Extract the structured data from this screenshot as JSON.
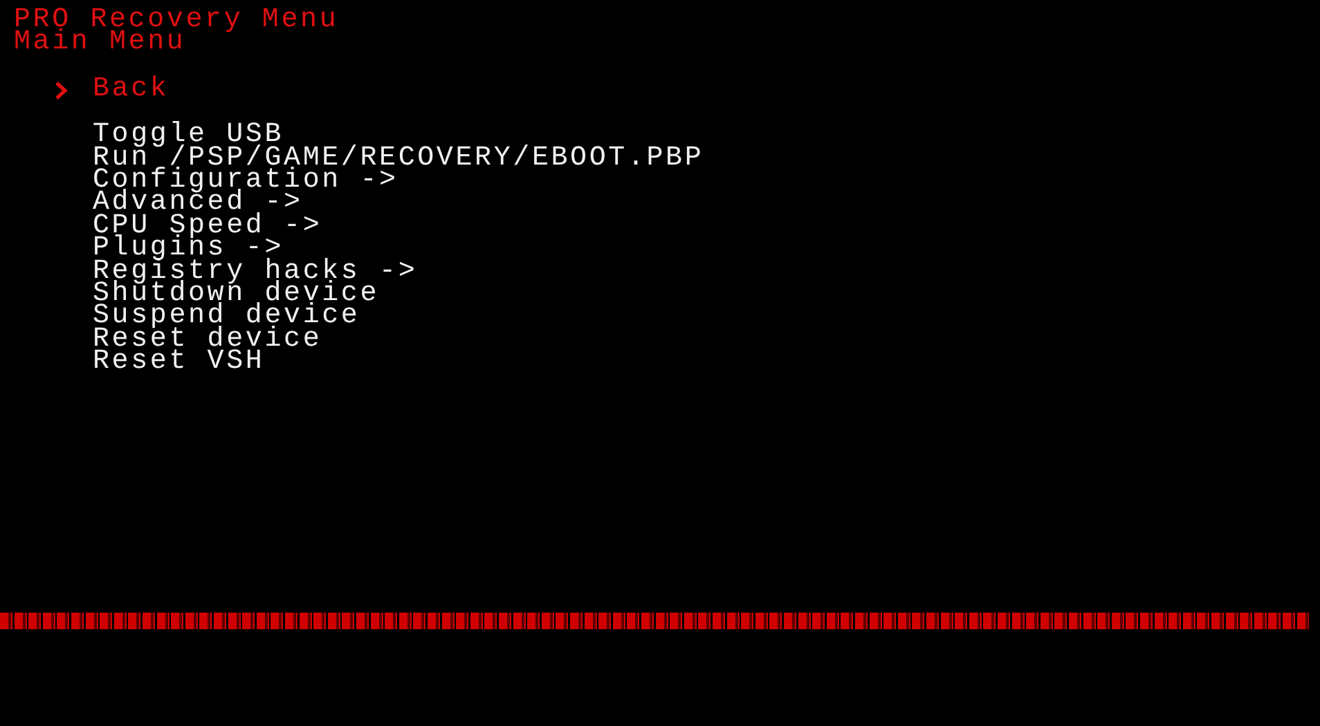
{
  "header": {
    "title": "PRO Recovery Menu",
    "subtitle": "Main Menu"
  },
  "items": [
    {
      "kind": "back",
      "label": "Back",
      "selected": true
    },
    {
      "kind": "entry",
      "label": "Toggle USB",
      "selected": false
    },
    {
      "kind": "entry",
      "label": "Run /PSP/GAME/RECOVERY/EBOOT.PBP",
      "selected": false
    },
    {
      "kind": "entry",
      "label": "Configuration ->",
      "selected": false
    },
    {
      "kind": "entry",
      "label": "Advanced ->",
      "selected": false
    },
    {
      "kind": "entry",
      "label": "CPU Speed ->",
      "selected": false
    },
    {
      "kind": "entry",
      "label": "Plugins ->",
      "selected": false
    },
    {
      "kind": "entry",
      "label": "Registry hacks ->",
      "selected": false
    },
    {
      "kind": "entry",
      "label": "Shutdown device",
      "selected": false
    },
    {
      "kind": "entry",
      "label": "Suspend device",
      "selected": false
    },
    {
      "kind": "entry",
      "label": "Reset device",
      "selected": false
    },
    {
      "kind": "entry",
      "label": "Reset VSH",
      "selected": false
    }
  ]
}
